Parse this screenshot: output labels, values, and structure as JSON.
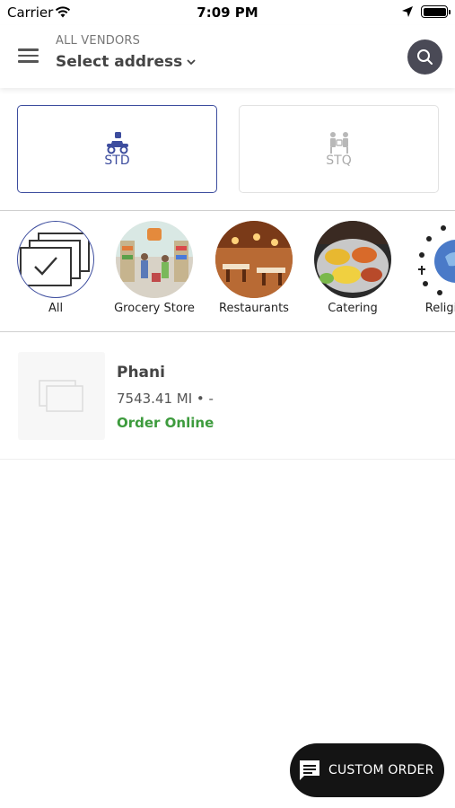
{
  "status_bar": {
    "carrier": "Carrier",
    "time": "7:09 PM"
  },
  "header": {
    "vendors_label": "ALL VENDORS",
    "address_label": "Select address"
  },
  "modes": [
    {
      "label": "STD",
      "selected": true
    },
    {
      "label": "STQ",
      "selected": false
    }
  ],
  "categories": [
    {
      "label": "All",
      "icon": "stacked-cards-check-icon"
    },
    {
      "label": "Grocery Store",
      "icon": "grocery-store-image"
    },
    {
      "label": "Restaurants",
      "icon": "restaurant-image"
    },
    {
      "label": "Catering",
      "icon": "catering-food-image"
    },
    {
      "label": "Religious",
      "icon": "religious-symbols-image"
    }
  ],
  "vendor": {
    "name": "Phani",
    "distance": "7543.41 MI • -",
    "cta": "Order Online"
  },
  "custom_order": {
    "label": "CUSTOM ORDER"
  },
  "colors": {
    "accent": "#3d4d9e",
    "order_online": "#3d9b3d",
    "custom_order_bg": "#141414",
    "search_bg": "#4a4a56"
  }
}
